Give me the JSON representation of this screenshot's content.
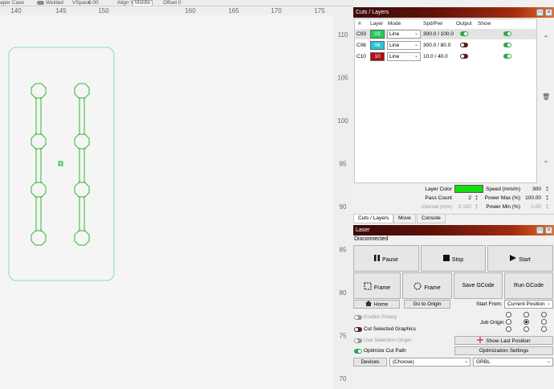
{
  "topbar": {
    "case_label": "aper Case",
    "welded_label": "Welded",
    "vspace_label": "VSpace",
    "vspace_value": "0.00",
    "aligny_label": "Align Y",
    "aligny_value": "Middle",
    "offset_label": "Offset",
    "offset_value": "0"
  },
  "canvas": {
    "x_ticks": [
      "140",
      "145",
      "150",
      "160",
      "165",
      "170",
      "175"
    ],
    "y_ticks": [
      "110",
      "105",
      "100",
      "95",
      "90",
      "85",
      "80",
      "75",
      "70"
    ],
    "shape_color": "#2eb82e",
    "selection_color": "#7fd9d9"
  },
  "cuts_layers": {
    "title": "Cuts / Layers",
    "headers": {
      "num": "#",
      "layer": "Layer",
      "mode": "Mode",
      "spd_pwr": "Spd/Pwr",
      "output": "Output",
      "show": "Show"
    },
    "rows": [
      {
        "num": "C03",
        "layer": "03",
        "color": "#22cc55",
        "text_color": "#ffffff",
        "mode": "Line",
        "spd_pwr": "300.0 / 100.0",
        "output": "on",
        "show": "on",
        "selected": true
      },
      {
        "num": "C06",
        "layer": "06",
        "color": "#22c8d8",
        "text_color": "#ffffff",
        "mode": "Line",
        "spd_pwr": "300.0 / 80.0",
        "output": "off",
        "show": "on",
        "selected": false
      },
      {
        "num": "C10",
        "layer": "10",
        "color": "#b01010",
        "text_color": "#ffffff",
        "mode": "Line",
        "spd_pwr": "10.0 / 40.0",
        "output": "off",
        "show": "on",
        "selected": false
      }
    ],
    "layer_color_label": "Layer Color",
    "layer_color": "#11dd11",
    "speed_label": "Speed (mm/m)",
    "speed_value": "300",
    "pass_count_label": "Pass Count",
    "pass_count_value": "2",
    "power_max_label": "Power Max (%)",
    "power_max_value": "100.00",
    "interval_label": "Interval (mm)",
    "interval_value": "0.100",
    "power_min_label": "Power Min (%)",
    "power_min_value": "0.00",
    "tabs": [
      "Cuts / Layers",
      "Move",
      "Console"
    ]
  },
  "laser": {
    "title": "Laser",
    "status": "Disconnected",
    "pause_label": "Pause",
    "stop_label": "Stop",
    "start_label": "Start",
    "frame1_label": "Frame",
    "frame2_label": "Frame",
    "save_gcode_label": "Save GCode",
    "run_gcode_label": "Run GCode",
    "home_label": "Home",
    "go_origin_label": "Go to Origin",
    "start_from_label": "Start From:",
    "start_from_value": "Current Position",
    "job_origin_label": "Job Origin",
    "job_origin_selected": 4,
    "enable_rotary_label": "Enable Rotary",
    "cut_selected_label": "Cut Selected Graphics",
    "use_selection_origin_label": "Use Selection Origin",
    "optimize_cut_label": "Optimize Cut Path",
    "show_last_position_label": "Show Last Position",
    "optimization_settings_label": "Optimization Settings",
    "devices_label": "Devices",
    "device_value": "(Choose)",
    "controller_value": "GRBL"
  }
}
